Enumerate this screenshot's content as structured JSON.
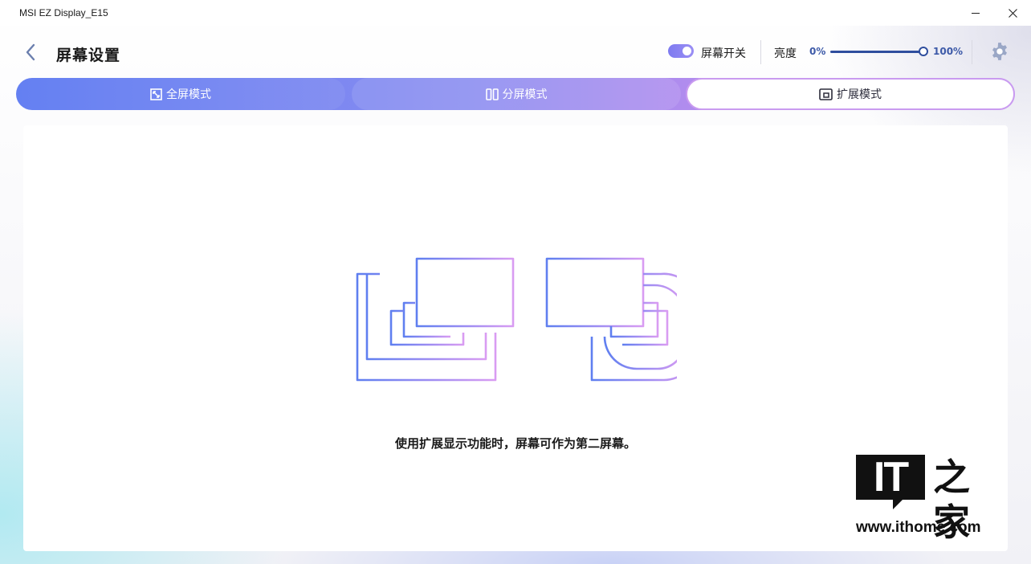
{
  "window": {
    "title": "MSI EZ Display_E15",
    "minimize_icon": "minimize-icon",
    "close_icon": "close-icon"
  },
  "header": {
    "back_icon": "chevron-left-icon",
    "title": "屏幕设置",
    "screen_switch": {
      "label": "屏幕开关",
      "on": true
    },
    "brightness": {
      "label": "亮度",
      "min_label": "0%",
      "max_label": "100%",
      "value_percent": 100
    },
    "settings_icon": "gear-icon"
  },
  "tabs": [
    {
      "label": "全屏模式",
      "icon": "fullscreen-icon",
      "selected": false
    },
    {
      "label": "分屏模式",
      "icon": "split-screen-icon",
      "selected": false
    },
    {
      "label": "扩展模式",
      "icon": "extend-screen-icon",
      "selected": true
    }
  ],
  "main": {
    "illustration": "extended-display-illustration",
    "caption": "使用扩展显示功能时，屏幕可作为第二屏幕。"
  },
  "watermark": {
    "logo_text": "IT",
    "logo_chars": "之家",
    "url": "www.ithome.com"
  },
  "colors": {
    "accent_blue": "#5b79f2",
    "accent_purple": "#c99bf0",
    "slider": "#2f4e9e"
  }
}
